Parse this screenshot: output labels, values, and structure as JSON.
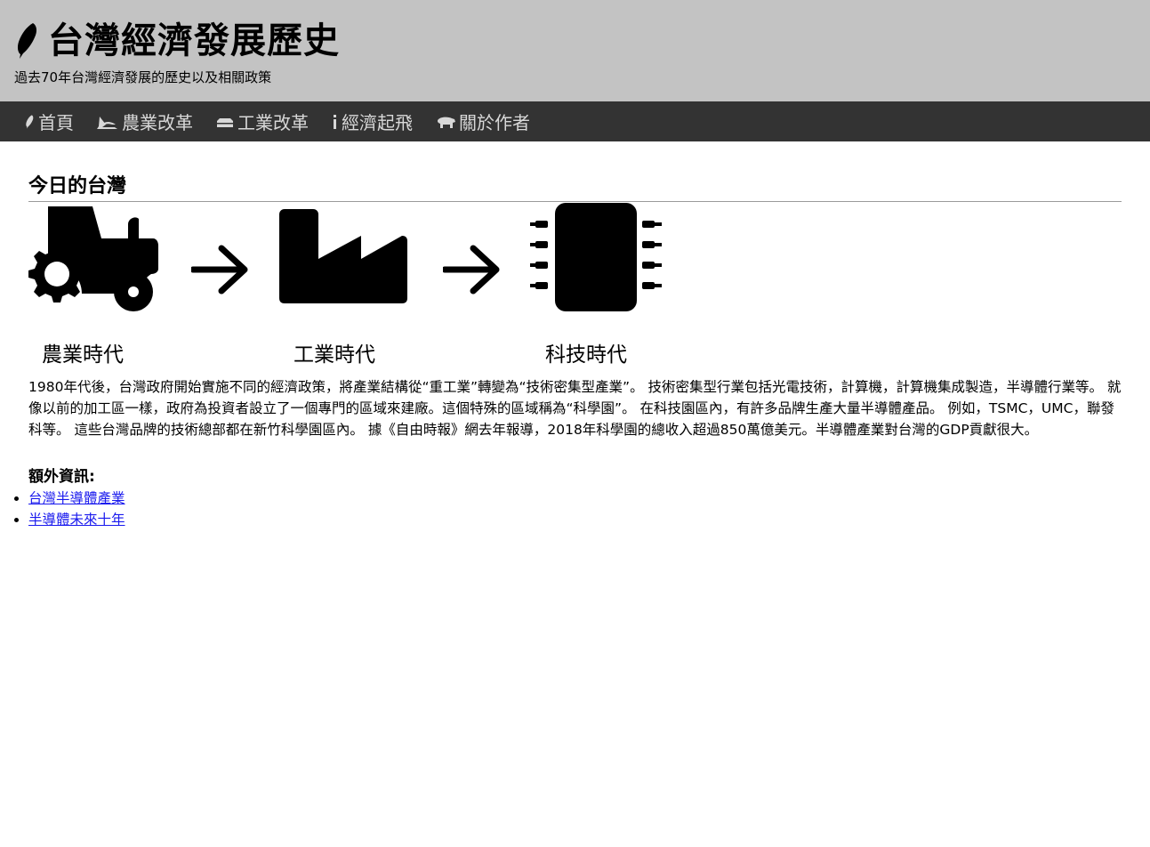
{
  "header": {
    "title": "台灣經濟發展歷史",
    "subtitle": "過去70年台灣經濟發展的歷史以及相關政策",
    "logo_icon": "taiwan-leaf-icon"
  },
  "nav": {
    "items": [
      {
        "label": "首頁",
        "icon": "taiwan-leaf-icon"
      },
      {
        "label": "農業改革",
        "icon": "sickle-icon"
      },
      {
        "label": "工業改革",
        "icon": "factory-icon"
      },
      {
        "label": "經濟起飛",
        "icon": "info-icon"
      },
      {
        "label": "關於作者",
        "icon": "bear-icon"
      }
    ]
  },
  "main": {
    "section_title": "今日的台灣",
    "eras": [
      {
        "label": "農業時代",
        "icon": "tractor-icon"
      },
      {
        "label": "工業時代",
        "icon": "factory-icon"
      },
      {
        "label": "科技時代",
        "icon": "microchip-icon"
      }
    ],
    "description": "1980年代後，台灣政府開始實施不同的經濟政策，將產業結構從“重工業”轉變為“技術密集型產業”。 技術密集型行業包括光電技術，計算機，計算機集成製造，半導體行業等。 就像以前的加工區一樣，政府為投資者設立了一個專門的區域來建廠。這個特殊的區域稱為“科學園”。 在科技園區內，有許多品牌生產大量半導體產品。 例如，TSMC，UMC，聯發科等。 這些台灣品牌的技術總部都在新竹科學園區內。 據《自由時報》網去年報導，2018年科學園的總收入超過850萬億美元。半導體產業對台灣的GDP貢獻很大。",
    "extra_title": "額外資訊:",
    "links": [
      {
        "label": "台灣半導體產業"
      },
      {
        "label": "半導體未來十年"
      }
    ]
  },
  "colors": {
    "header_bg": "#c3c3c3",
    "nav_bg": "#333333",
    "nav_text": "#d8d8d8",
    "link": "#1a1aee"
  }
}
